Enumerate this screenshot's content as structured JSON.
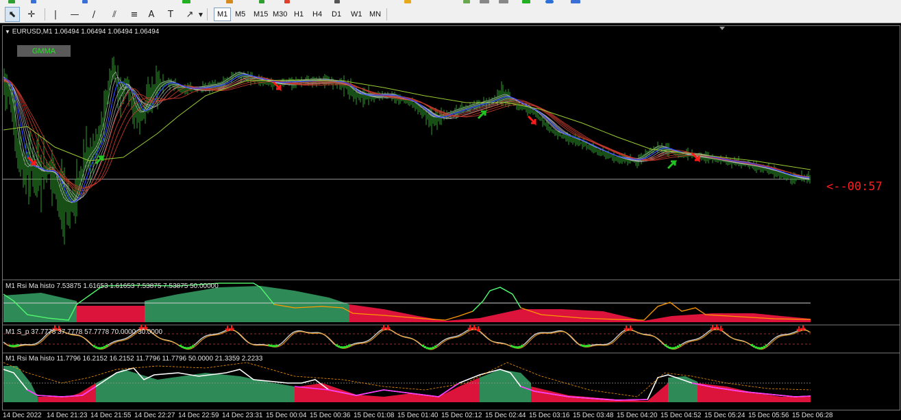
{
  "toolbar": {
    "tools": [
      {
        "name": "cursor-tool-icon",
        "glyph": "⬉"
      },
      {
        "name": "crosshair-tool-icon",
        "glyph": "✛"
      },
      {
        "name": "vertical-line-tool-icon",
        "glyph": "|"
      },
      {
        "name": "horizontal-line-tool-icon",
        "glyph": "—"
      },
      {
        "name": "trendline-tool-icon",
        "glyph": "∕"
      },
      {
        "name": "channel-tool-icon",
        "glyph": "⫽"
      },
      {
        "name": "fibonacci-tool-icon",
        "glyph": "≡"
      },
      {
        "name": "text-tool-icon",
        "glyph": "A"
      },
      {
        "name": "text-label-tool-icon",
        "glyph": "T"
      },
      {
        "name": "arrow-tool-icon",
        "glyph": "↗"
      }
    ],
    "timeframes": [
      "M1",
      "M5",
      "M15",
      "M30",
      "H1",
      "H4",
      "D1",
      "W1",
      "MN"
    ],
    "active_timeframe": "M1"
  },
  "chart": {
    "header": "EURUSD,M1  1.06494 1.06494 1.06494 1.06494",
    "gmma_button": "GMMA",
    "countdown": "<--00:57",
    "subwindows": [
      "M1 Rsi Ma histo 7.53875 1.61653 1.61653 7.53875 7.53875 50.00000",
      "M1 S_p 37.7778 37.7778 57.7778 70.0000 30.0000",
      "M1 Rsi Ma histo 11.7796 16.2152 16.2152 11.7796 11.7796 50.0000 21.3359 2.2233"
    ],
    "time_axis": [
      "14 Dec 2022",
      "14 Dec 21:23",
      "14 Dec 21:55",
      "14 Dec 22:27",
      "14 Dec 22:59",
      "14 Dec 23:31",
      "15 Dec 00:04",
      "15 Dec 00:36",
      "15 Dec 01:08",
      "15 Dec 01:40",
      "15 Dec 02:12",
      "15 Dec 02:44",
      "15 Dec 03:16",
      "15 Dec 03:48",
      "15 Dec 04:20",
      "15 Dec 04:52",
      "15 Dec 05:24",
      "15 Dec 05:56",
      "15 Dec 06:28"
    ],
    "colors": {
      "background": "#000000",
      "bars": "#2e9e2e",
      "gmma_short": "#bfbfbf",
      "gmma_long": "#c0392b",
      "blue_ma": "#2b3fff",
      "yellow_ma": "#9acd32",
      "buy_arrow": "#22c322",
      "sell_arrow": "#ff1a1a",
      "histo_green": "#2e8b57",
      "histo_red": "#dc143c",
      "rsi_line_green": "#3dff7a",
      "rsi_line_orange": "#ff9900",
      "countdown": "#ff1c1c"
    }
  }
}
